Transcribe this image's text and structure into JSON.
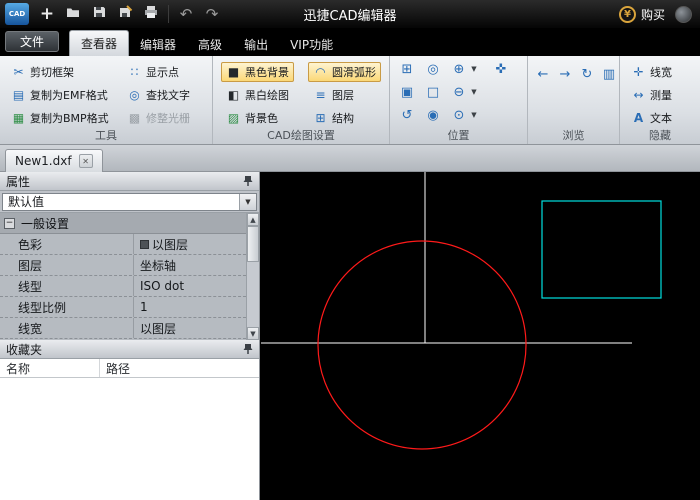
{
  "titlebar": {
    "logo": "CAD",
    "title": "迅捷CAD编辑器",
    "yuan": "¥",
    "buy_label": "购买"
  },
  "ribbon_tabs": {
    "file": "文件",
    "viewer": "查看器",
    "editor": "编辑器",
    "advanced": "高级",
    "output": "输出",
    "vip": "VIP功能"
  },
  "ribbon": {
    "tools": {
      "label": "工具",
      "cut_frame": "剪切框架",
      "copy_emf": "复制为EMF格式",
      "copy_bmp": "复制为BMP格式",
      "show_points": "显示点",
      "find_text": "查找文字",
      "trim_raster": "修整光栅"
    },
    "cad_settings": {
      "label": "CAD绘图设置",
      "black_bg": "黑色背景",
      "smooth_arc": "圆滑弧形",
      "bw_drawing": "黑白绘图",
      "layers": "图层",
      "bg_color": "背景色",
      "structure": "结构"
    },
    "position": {
      "label": "位置"
    },
    "browse": {
      "label": "浏览"
    },
    "hide": {
      "label": "隐藏",
      "line_width": "线宽",
      "measure": "测量",
      "text": "文本"
    }
  },
  "doc_tab": "New1.dxf",
  "properties": {
    "title": "属性",
    "preset": "默认值",
    "group": "一般设置",
    "rows": [
      {
        "name": "色彩",
        "value": "以图层"
      },
      {
        "name": "图层",
        "value": "坐标轴"
      },
      {
        "name": "线型",
        "value": "ISO dot"
      },
      {
        "name": "线型比例",
        "value": "1"
      },
      {
        "name": "线宽",
        "value": "以图层"
      }
    ]
  },
  "favorites": {
    "title": "收藏夹",
    "col_name": "名称",
    "col_path": "路径"
  },
  "canvas": {
    "bg": "#000000",
    "axis_color": "#ffffff",
    "circle_color": "#ff1a1a",
    "rect_color": "#00e0e0"
  },
  "icons": {
    "plus": "+",
    "undo": "↶",
    "redo": "↷",
    "cut": "✂",
    "copy_doc": "▤",
    "copy_bmp": "▦",
    "show_points": "∷",
    "find": "◎",
    "raster": "▩",
    "black_square": "■",
    "arc": "◠",
    "bw": "◧",
    "layers": "≡",
    "bg_color": "▨",
    "structure": "⊞",
    "zoom_window": "⊞",
    "zoom_dynamic": "◎",
    "zoom_in": "⊕",
    "pan": "✜",
    "zoom_rect": "▣",
    "zoom_extents": "□",
    "zoom_out": "⊖",
    "rotate": "↺",
    "zoom_target": "◉",
    "zoom_center": "⊙",
    "back": "←",
    "forward": "→",
    "layout": "↻",
    "model": "▥",
    "line_width": "✛",
    "measure": "↔",
    "text_tool": "A",
    "caret": "▼",
    "close": "✕",
    "up": "▲",
    "down": "▼",
    "collapse": "−"
  }
}
